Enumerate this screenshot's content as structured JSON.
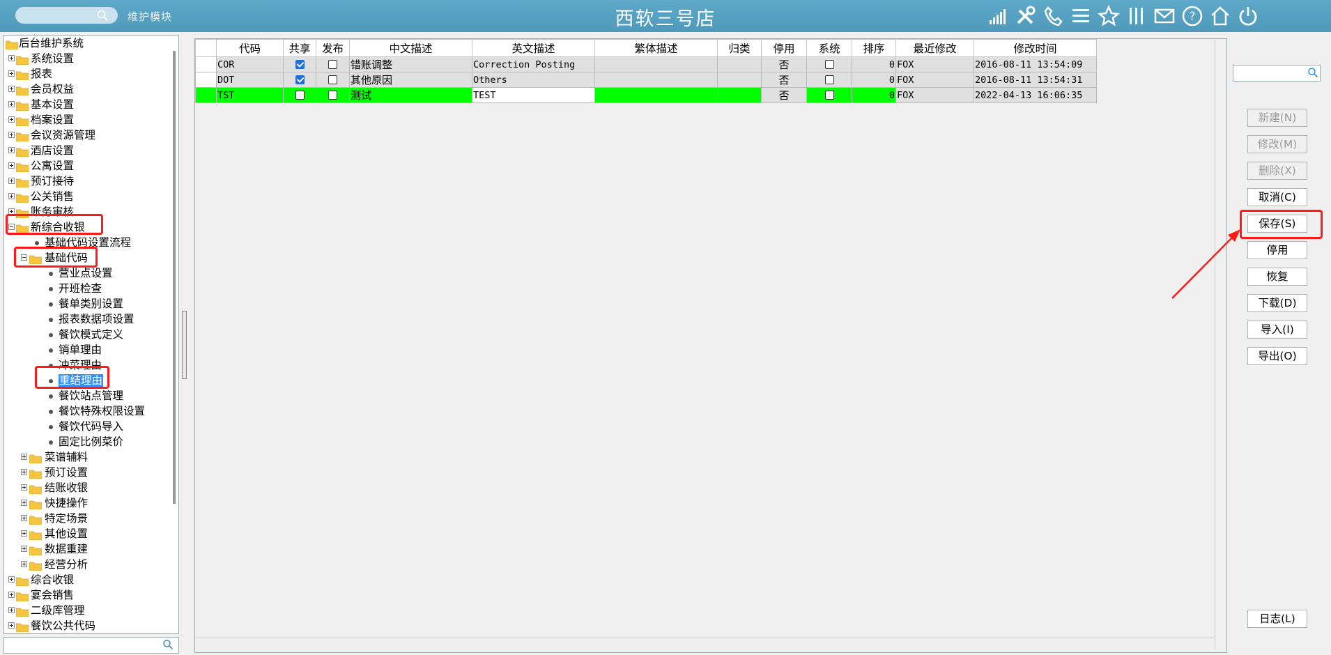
{
  "header": {
    "search_placeholder": "",
    "module_label": "维护模块",
    "store_title": "西软三号店",
    "icons": [
      "signal-icon",
      "tools-icon",
      "phone-icon",
      "menu-icon",
      "star-icon",
      "columns-icon",
      "mail-icon",
      "help-icon",
      "home-icon",
      "power-icon"
    ]
  },
  "tree": {
    "root": "后台维护系统",
    "top_items": [
      "系统设置",
      "报表",
      "会员权益",
      "基本设置",
      "档案设置",
      "会议资源管理",
      "酒店设置",
      "公寓设置",
      "预订接待",
      "公关销售",
      "账务审核"
    ],
    "expanded": "新综合收银",
    "expanded_children": {
      "flow": "基础代码设置流程",
      "basic_code": "基础代码",
      "basic_code_children": [
        "营业点设置",
        "开班检查",
        "餐单类别设置",
        "报表数据项设置",
        "餐饮模式定义",
        "销单理由",
        "冲菜理由",
        "重结理由",
        "餐饮站点管理",
        "餐饮特殊权限设置",
        "餐饮代码导入",
        "固定比例菜价"
      ],
      "selected": "重结理由",
      "other_folders": [
        "菜谱辅料",
        "预订设置",
        "结账收银",
        "快捷操作",
        "特定场景",
        "其他设置",
        "数据重建",
        "经营分析"
      ]
    },
    "bottom_items": [
      "综合收银",
      "宴会销售",
      "二级库管理",
      "餐饮公共代码"
    ],
    "search_placeholder": ""
  },
  "grid": {
    "columns": [
      "代码",
      "共享",
      "发布",
      "中文描述",
      "英文描述",
      "繁体描述",
      "归类",
      "停用",
      "系统",
      "排序",
      "最近修改",
      "修改时间"
    ],
    "rows": [
      {
        "code": "COR",
        "shared": true,
        "publish": false,
        "cn": "错账调整",
        "en": "Correction Posting",
        "tw": "",
        "category": "",
        "disabled": "否",
        "system": false,
        "sort": "0",
        "modifier": "FOX",
        "time": "2016-08-11 13:54:09",
        "state": "normal"
      },
      {
        "code": "DOT",
        "shared": true,
        "publish": false,
        "cn": "其他原因",
        "en": "Others",
        "tw": "",
        "category": "",
        "disabled": "否",
        "system": false,
        "sort": "0",
        "modifier": "FOX",
        "time": "2016-08-11 13:54:31",
        "state": "normal"
      },
      {
        "code": "TST",
        "shared": false,
        "publish": false,
        "cn": "测试",
        "en": "TEST",
        "tw": "",
        "category": "",
        "disabled": "否",
        "system": false,
        "sort": "0",
        "modifier": "FOX",
        "time": "2022-04-13 16:06:35",
        "state": "new"
      }
    ]
  },
  "actions": {
    "search_placeholder": "",
    "buttons": [
      {
        "label": "新建(N)",
        "enabled": false
      },
      {
        "label": "修改(M)",
        "enabled": false
      },
      {
        "label": "删除(X)",
        "enabled": false
      },
      {
        "label": "取消(C)",
        "enabled": true
      },
      {
        "label": "保存(S)",
        "enabled": true
      },
      {
        "label": "停用",
        "enabled": true
      },
      {
        "label": "恢复",
        "enabled": true
      },
      {
        "label": "下载(D)",
        "enabled": true
      },
      {
        "label": "导入(I)",
        "enabled": true
      },
      {
        "label": "导出(O)",
        "enabled": true
      }
    ],
    "log_button": "日志(L)"
  },
  "colors": {
    "header_bg": "#5ea8c8",
    "new_row": "#00ff00",
    "selection": "#3390ff",
    "annotation": "#ff1a1a"
  }
}
